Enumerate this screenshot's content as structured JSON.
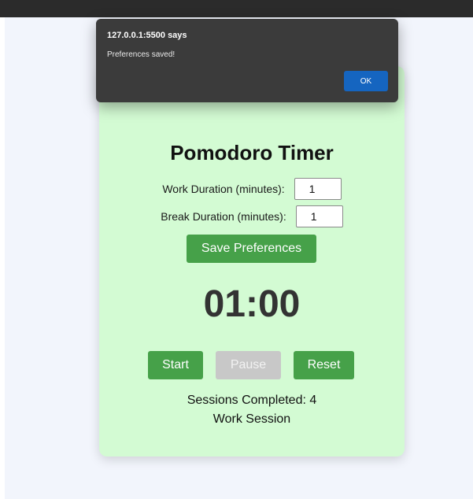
{
  "alert": {
    "title": "127.0.0.1:5500 says",
    "message": "Preferences saved!",
    "ok_label": "OK"
  },
  "app": {
    "title": "Pomodoro Timer",
    "work": {
      "label": "Work Duration (minutes):",
      "value": "1"
    },
    "break": {
      "label": "Break Duration (minutes):",
      "value": "1"
    },
    "save_label": "Save Preferences",
    "timer": "01:00",
    "controls": {
      "start_label": "Start",
      "pause_label": "Pause",
      "reset_label": "Reset"
    },
    "sessions_text": "Sessions Completed: 4",
    "session_type": "Work Session"
  },
  "colors": {
    "card_bg": "#d3fbd3",
    "accent_green": "#46a149",
    "disabled_gray": "#c8c8c8",
    "dialog_bg": "#3b3b3b",
    "dialog_button": "#1565c0"
  }
}
